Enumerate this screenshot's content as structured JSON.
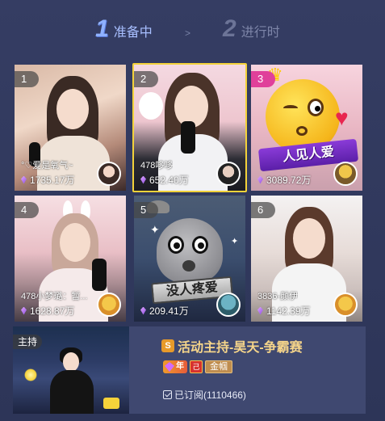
{
  "steps": [
    {
      "num": "1",
      "label": "准备中",
      "active": true
    },
    {
      "num": "2",
      "label": "进行时",
      "active": false
    }
  ],
  "step_separator": ">",
  "cards": [
    {
      "rank": "1",
      "name": "°♡爱是氧气~",
      "hot": "1735.17万",
      "selected": false
    },
    {
      "rank": "2",
      "name": "478哆哆",
      "hot": "652.40万",
      "selected": true
    },
    {
      "rank": "3",
      "name": "",
      "hot": "3089.72万",
      "selected": false,
      "sticker_text": "人见人爱"
    },
    {
      "rank": "4",
      "name": "478小梦璐：暂...",
      "hot": "1628.87万",
      "selected": false
    },
    {
      "rank": "5",
      "name": "",
      "hot": "209.41万",
      "selected": false,
      "sticker_text": "没人疼爱"
    },
    {
      "rank": "6",
      "name": "3836-颜伊",
      "hot": "1142.39万",
      "selected": false
    }
  ],
  "host": {
    "tag": "主持",
    "title": "活动主持-昊天-争霸赛",
    "title_icon": "S",
    "badge_year": "年",
    "badge_box": "己",
    "badge_name": "金帼",
    "subscribed": "已订阅(1110466)"
  },
  "colors": {
    "background": "#2b3356",
    "selected_border": "#f3d23a",
    "host_title": "#f6d58a",
    "active_step": "#a8bfff"
  }
}
